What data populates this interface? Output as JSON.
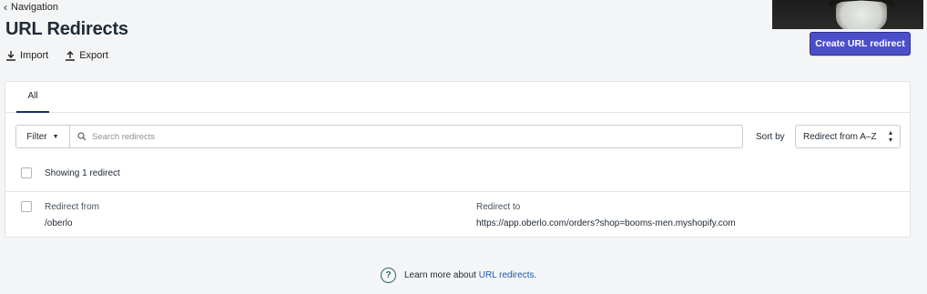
{
  "breadcrumb": {
    "label": "Navigation"
  },
  "page": {
    "title": "URL Redirects"
  },
  "actions": {
    "import_label": "Import",
    "export_label": "Export"
  },
  "primary_button": {
    "label": "Create URL redirect"
  },
  "tabs": [
    {
      "label": "All",
      "selected": true
    }
  ],
  "filter": {
    "label": "Filter"
  },
  "search": {
    "placeholder": "Search redirects",
    "value": ""
  },
  "sort": {
    "label": "Sort by",
    "selected": "Redirect from A–Z"
  },
  "list": {
    "showing_text": "Showing 1 redirect",
    "rows": [
      {
        "from_label": "Redirect from",
        "from_value": "/oberlo",
        "to_label": "Redirect to",
        "to_value": "https://app.oberlo.com/orders?shop=booms-men.myshopify.com"
      }
    ]
  },
  "footer": {
    "prefix": "Learn more about ",
    "link_text": "URL redirects",
    "suffix": "."
  },
  "colors": {
    "primary": "#4b4fc7",
    "tab_underline": "#1b2a6b",
    "link": "#1a5ba8",
    "help_icon": "#2d6a5e"
  },
  "icons": {
    "breadcrumb": "chevron-left-icon",
    "import": "download-icon",
    "export": "upload-icon",
    "search": "search-icon",
    "help": "question-circle-icon"
  }
}
